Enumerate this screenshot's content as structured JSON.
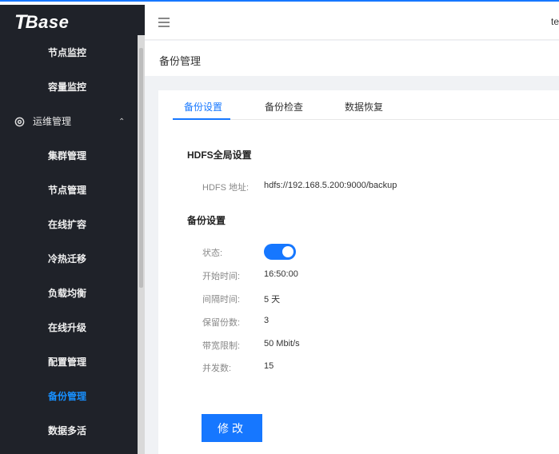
{
  "app": {
    "logo": "Base",
    "logo_t": "T"
  },
  "header": {
    "user": "te"
  },
  "sidebar": {
    "items": [
      {
        "label": "节点监控",
        "type": "sub"
      },
      {
        "label": "容量监控",
        "type": "sub"
      },
      {
        "label": "运维管理",
        "type": "group"
      },
      {
        "label": "集群管理",
        "type": "sub"
      },
      {
        "label": "节点管理",
        "type": "sub"
      },
      {
        "label": "在线扩容",
        "type": "sub"
      },
      {
        "label": "冷热迁移",
        "type": "sub"
      },
      {
        "label": "负载均衡",
        "type": "sub"
      },
      {
        "label": "在线升级",
        "type": "sub"
      },
      {
        "label": "配置管理",
        "type": "sub"
      },
      {
        "label": "备份管理",
        "type": "active"
      },
      {
        "label": "数据多活",
        "type": "sub"
      }
    ]
  },
  "page": {
    "title": "备份管理"
  },
  "tabs": [
    {
      "label": "备份设置",
      "active": true
    },
    {
      "label": "备份检查",
      "active": false
    },
    {
      "label": "数据恢复",
      "active": false
    }
  ],
  "hdfs": {
    "section_title": "HDFS全局设置",
    "address_label": "HDFS 地址:",
    "address_value": "hdfs://192.168.5.200:9000/backup"
  },
  "backup": {
    "section_title": "备份设置",
    "status_label": "状态:",
    "status_on": true,
    "start_label": "开始时间:",
    "start_value": "16:50:00",
    "interval_label": "间隔时间:",
    "interval_value": "5 天",
    "retain_label": "保留份数:",
    "retain_value": "3",
    "bandwidth_label": "带宽限制:",
    "bandwidth_value": "50 Mbit/s",
    "concurrency_label": "并发数:",
    "concurrency_value": "15",
    "edit_button": "修改"
  },
  "colors": {
    "accent": "#1677ff",
    "sidebar_bg": "#1f2229"
  }
}
